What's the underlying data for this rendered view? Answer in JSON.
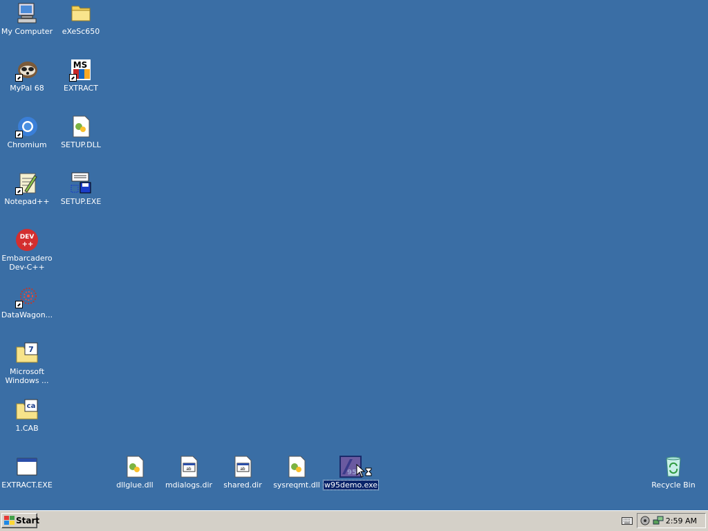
{
  "desktop": {
    "background": "#3a6ea5",
    "icons": [
      {
        "label": "My Computer",
        "icon": "my-computer-icon"
      },
      {
        "label": "eXeSc650",
        "icon": "folder-icon"
      },
      {
        "label": "MyPal 68",
        "icon": "mypal-icon",
        "shortcut": true
      },
      {
        "label": "EXTRACT",
        "icon": "extract-ms-icon",
        "shortcut": true
      },
      {
        "label": "Chromium",
        "icon": "chromium-icon",
        "shortcut": true
      },
      {
        "label": "SETUP.DLL",
        "icon": "dll-file-icon"
      },
      {
        "label": "Notepad++",
        "icon": "notepad-plus-plus-icon",
        "shortcut": true
      },
      {
        "label": "SETUP.EXE",
        "icon": "setup-exe-icon"
      },
      {
        "label": "Embarcadero Dev-C++",
        "icon": "dev-cpp-icon"
      },
      {
        "label": "DataWagon...",
        "icon": "datawagon-icon",
        "shortcut": true
      },
      {
        "label": "Microsoft Windows ...",
        "icon": "zip-folder-icon"
      },
      {
        "label": "1.CAB",
        "icon": "cab-folder-icon"
      },
      {
        "label": "EXTRACT.EXE",
        "icon": "exe-window-icon"
      },
      {
        "label": "dllglue.dll",
        "icon": "dll-file-icon"
      },
      {
        "label": "mdialogs.dir",
        "icon": "dir-file-icon"
      },
      {
        "label": "shared.dir",
        "icon": "dir-file-icon"
      },
      {
        "label": "sysreqmt.dll",
        "icon": "dll-file-icon"
      },
      {
        "label": "w95demo.exe",
        "icon": "w95demo-icon",
        "selected": true
      },
      {
        "label": "Recycle Bin",
        "icon": "recycle-bin-icon"
      }
    ]
  },
  "taskbar": {
    "start_label": "Start",
    "clock": "2:59 AM"
  }
}
